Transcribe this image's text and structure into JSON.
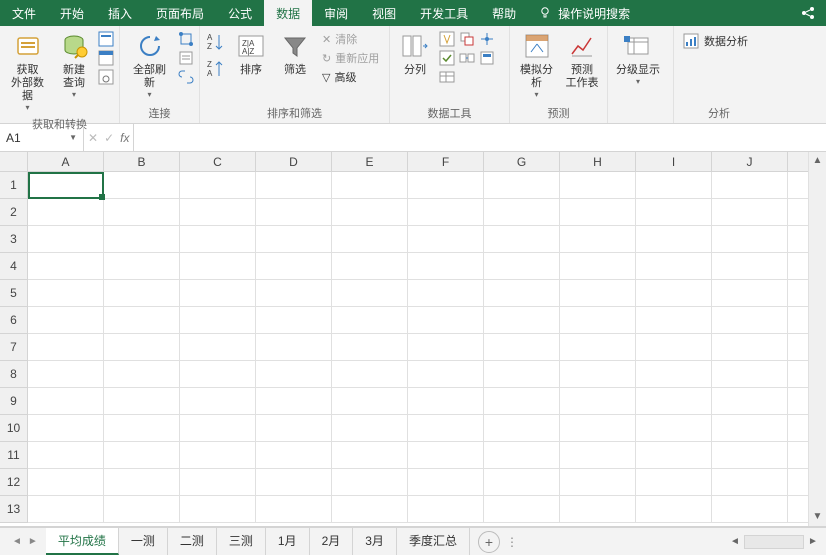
{
  "menu": {
    "file": "文件",
    "home": "开始",
    "insert": "插入",
    "page_layout": "页面布局",
    "formulas": "公式",
    "data": "数据",
    "review": "审阅",
    "view": "视图",
    "developer": "开发工具",
    "help": "帮助",
    "tell_me": "操作说明搜索"
  },
  "ribbon": {
    "group1": {
      "get_data": "获取\n外部数据",
      "label": "获取和转换",
      "new_query": "新建\n查询",
      "show_queries": "",
      "from_table": "",
      "recent": ""
    },
    "group2": {
      "refresh_all": "全部刷新",
      "label": "连接",
      "connections": "",
      "properties": "",
      "edit_links": ""
    },
    "group3": {
      "sort_az": "",
      "sort_za": "",
      "sort": "排序",
      "filter": "筛选",
      "clear": "清除",
      "reapply": "重新应用",
      "advanced": "高级",
      "label": "排序和筛选"
    },
    "group4": {
      "text_to_cols": "分列",
      "label": "数据工具"
    },
    "group5": {
      "whatif": "模拟分析",
      "forecast": "预测\n工作表",
      "label": "预测"
    },
    "group6": {
      "outline": "分级显示",
      "label": ""
    },
    "group7": {
      "data_analysis": "数据分析",
      "label": "分析"
    }
  },
  "name_box": "A1",
  "columns": [
    "A",
    "B",
    "C",
    "D",
    "E",
    "F",
    "G",
    "H",
    "I",
    "J"
  ],
  "rows": [
    "1",
    "2",
    "3",
    "4",
    "5",
    "6",
    "7",
    "8",
    "9",
    "10",
    "11",
    "12",
    "13"
  ],
  "sheets": [
    "平均成绩",
    "一测",
    "二测",
    "三测",
    "1月",
    "2月",
    "3月",
    "季度汇总"
  ],
  "active_sheet_index": 0,
  "colors": {
    "primary": "#217346"
  }
}
